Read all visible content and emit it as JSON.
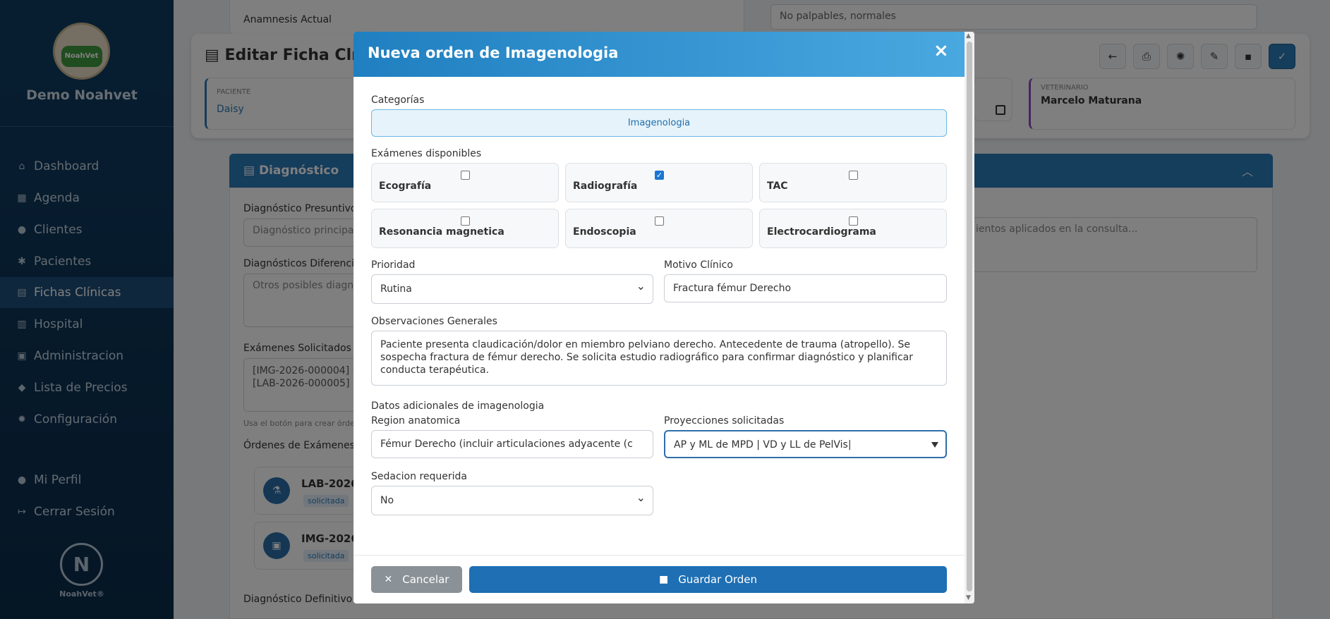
{
  "sidebar": {
    "logo_text": "NoahVet",
    "clinic_name": "Demo Noahvet",
    "items": [
      {
        "label": "Dashboard",
        "icon": "home-icon"
      },
      {
        "label": "Agenda",
        "icon": "calendar-icon"
      },
      {
        "label": "Clientes",
        "icon": "users-icon"
      },
      {
        "label": "Pacientes",
        "icon": "paw-icon"
      },
      {
        "label": "Fichas Clínicas",
        "icon": "file-medical-icon"
      },
      {
        "label": "Hospital",
        "icon": "hospital-icon"
      },
      {
        "label": "Administracion",
        "icon": "admin-icon"
      },
      {
        "label": "Lista de Precios",
        "icon": "tags-icon"
      },
      {
        "label": "Configuración",
        "icon": "gear-icon"
      }
    ],
    "profile": "Mi Perfil",
    "logout": "Cerrar Sesión",
    "brand": "NoahVet®"
  },
  "background": {
    "anamnesis_label": "Anamnesis Actual",
    "palpation_value": "No palpables, normales",
    "header_title": "Editar Ficha Clínica",
    "patient_label": "PACIENTE",
    "patient_name": "Daisy",
    "vet_label": "VETERINARIO",
    "vet_name": "Marcelo Maturana",
    "section_title": "Diagnóstico",
    "presuntivo_label": "Diagnóstico Presuntivo",
    "presuntivo_placeholder": "Diagnóstico principal",
    "diferencial_label": "Diagnósticos Diferencia",
    "diferencial_placeholder": "Otros posibles diagn",
    "examenes_label": "Exámenes Solicitados",
    "examenes_line1": "[IMG-2026-000004] (",
    "examenes_line2": "[LAB-2026-000005] (",
    "helper_text": "Usa el botón para crear órde",
    "ordenes_label": "Órdenes de Exámenes C",
    "order1_code": "LAB-2026-",
    "order1_status": "solicitada",
    "order2_code": "IMG-2026-",
    "order2_status": "solicitada",
    "definitivo_label": "Diagnóstico Definitivo",
    "tratamiento_placeholder": "ientos aplicados en la consulta..."
  },
  "modal": {
    "title": "Nueva orden de Imagenologia",
    "close": "×",
    "categorias_label": "Categorías",
    "categoria": "Imagenologia",
    "examenes_label": "Exámenes disponibles",
    "exams": [
      {
        "name": "Ecografía",
        "checked": false
      },
      {
        "name": "Radiografía",
        "checked": true
      },
      {
        "name": "TAC",
        "checked": false
      },
      {
        "name": "Resonancia magnetica",
        "checked": false
      },
      {
        "name": "Endoscopia",
        "checked": false
      },
      {
        "name": "Electrocardiograma",
        "checked": false
      }
    ],
    "prioridad_label": "Prioridad",
    "prioridad_value": "Rutina",
    "motivo_label": "Motivo Clínico",
    "motivo_value": "Fractura fémur Derecho",
    "observaciones_label": "Observaciones Generales",
    "observaciones_value": "Paciente presenta claudicación/dolor en miembro pelviano derecho. Antecedente de trauma (atropello). Se sospecha fractura de fémur derecho. Se solicita estudio radiográfico para confirmar diagnóstico y planificar conducta terapéutica.",
    "datos_label": "Datos adicionales de imagenologia",
    "region_label": "Region anatomica",
    "region_value": "Fémur Derecho (incluir articulaciones adyacente (c",
    "proyecciones_label": "Proyecciones solicitadas",
    "proyecciones_value": "AP y ML de MPD | VD y LL de PelVis",
    "sedacion_label": "Sedacion requerida",
    "sedacion_value": "No",
    "cancel_label": "Cancelar",
    "save_label": "Guardar Orden"
  }
}
